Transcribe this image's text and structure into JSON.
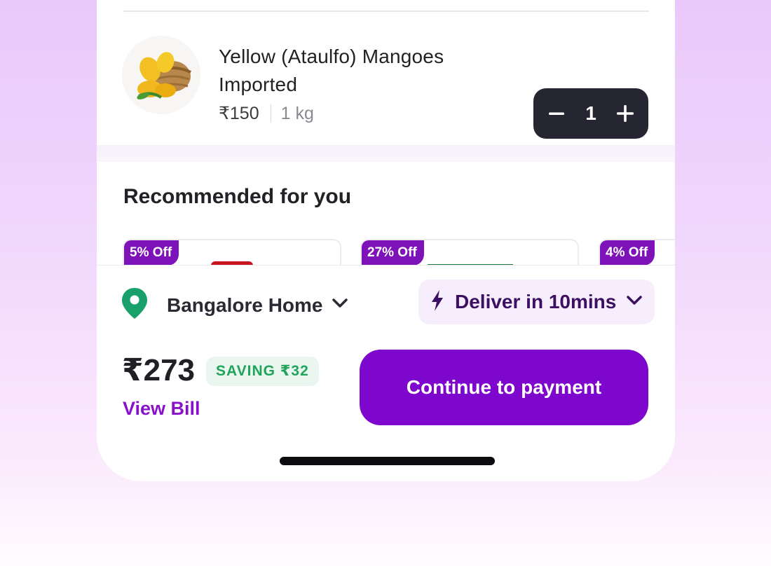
{
  "cart_item": {
    "title": "Yellow (Ataulfo) Mangoes Imported",
    "price": "₹150",
    "unit": "1 kg",
    "quantity": "1",
    "image": "mango-basket-image"
  },
  "recommended": {
    "title": "Recommended for you",
    "cards": [
      {
        "badge": "5% Off",
        "accent": "#c8141e"
      },
      {
        "badge": "27% Off",
        "accent": "#1f7a37"
      },
      {
        "badge": "4% Off",
        "accent": "#ffffff"
      }
    ]
  },
  "delivery": {
    "location": "Bangalore Home",
    "eta": "Deliver in 10mins"
  },
  "checkout": {
    "total": "₹273",
    "saving": "SAVING ₹32",
    "view_bill": "View Bill",
    "pay_label": "Continue to payment"
  },
  "colors": {
    "brand_purple": "#7d07cc",
    "badge_purple": "#7d12b8",
    "saving_green": "#22a35a",
    "stepper_dark": "#262633",
    "location_pin_green": "#1aa06b"
  },
  "icons": [
    "minus-icon",
    "plus-icon",
    "location-pin-icon",
    "chevron-down-icon",
    "lightning-bolt-icon"
  ]
}
